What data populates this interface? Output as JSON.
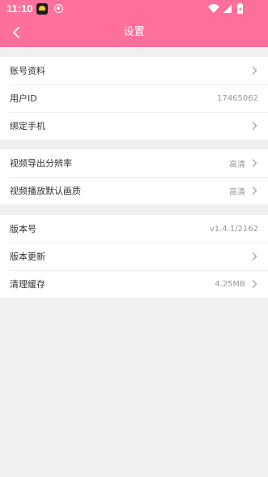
{
  "status_bar": {
    "time": "11:10",
    "app_icon": "app-notification-icon",
    "notif_icon": "location-notification-icon",
    "icons": [
      "wifi-icon",
      "cellular-signal-icon",
      "battery-icon"
    ]
  },
  "header": {
    "title": "设置",
    "back_icon": "chevron-left-icon",
    "background": "#ff6f9c"
  },
  "groups": [
    {
      "rows": [
        {
          "label": "账号资料",
          "value": "",
          "arrow": true
        },
        {
          "label": "用户ID",
          "value": "17465062",
          "arrow": false
        },
        {
          "label": "绑定手机",
          "value": "",
          "arrow": true
        }
      ]
    },
    {
      "rows": [
        {
          "label": "视频导出分辨率",
          "value": "高清",
          "arrow": true
        },
        {
          "label": "视频播放默认画质",
          "value": "高清",
          "arrow": true
        }
      ]
    },
    {
      "rows": [
        {
          "label": "版本号",
          "value": "v1.4.1/2162",
          "arrow": false
        },
        {
          "label": "版本更新",
          "value": "",
          "arrow": true
        },
        {
          "label": "清理缓存",
          "value": "4.25MB",
          "arrow": true
        }
      ]
    }
  ]
}
